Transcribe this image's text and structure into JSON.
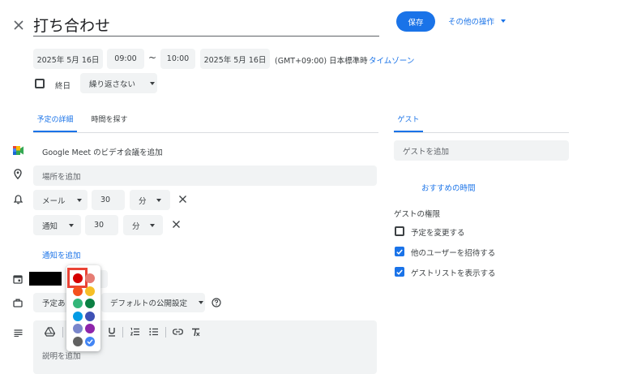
{
  "colors": {
    "accent": "#1a73e8",
    "chip_bg": "#f1f3f4",
    "text": "#3c4043",
    "highlight": "#ea4335"
  },
  "header": {
    "close_icon": "close-icon",
    "title": "打ち合わせ",
    "save_label": "保存",
    "more_actions_label": "その他の操作"
  },
  "datetime": {
    "start_date": "2025年 5月 16日",
    "start_time": "09:00",
    "separator": "~",
    "end_time": "10:00",
    "end_date": "2025年 5月 16日",
    "timezone_text": "(GMT+09:00) 日本標準時",
    "timezone_link": "タイムゾーン",
    "all_day_label": "終日",
    "all_day_checked": false,
    "repeat_label": "繰り返さない"
  },
  "tabs": [
    {
      "label": "予定の詳細",
      "active": true
    },
    {
      "label": "時間を探す",
      "active": false
    }
  ],
  "details": {
    "meet_label": "Google Meet のビデオ会議を追加",
    "location_placeholder": "場所を追加",
    "notifications": [
      {
        "type": "メール",
        "value": "30",
        "unit": "分"
      },
      {
        "type": "通知",
        "value": "30",
        "unit": "分"
      }
    ],
    "add_notification": "通知を追加",
    "availability_label": "予定あり",
    "visibility_label": "デフォルトの公開設定",
    "description_placeholder": "説明を追加"
  },
  "color_picker": {
    "selected": "#d50000",
    "colors": [
      "#d50000",
      "#e67c73",
      "#f4511e",
      "#f6bf26",
      "#33b679",
      "#0b8043",
      "#039be5",
      "#3f51b5",
      "#7986cb",
      "#8e24aa",
      "#616161",
      "#4285f4"
    ]
  },
  "guests": {
    "tab_label": "ゲスト",
    "add_placeholder": "ゲストを追加",
    "suggested_times": "おすすめの時間",
    "permissions_title": "ゲストの権限",
    "permissions": [
      {
        "label": "予定を変更する",
        "checked": false
      },
      {
        "label": "他のユーザーを招待する",
        "checked": true
      },
      {
        "label": "ゲストリストを表示する",
        "checked": true
      }
    ]
  }
}
